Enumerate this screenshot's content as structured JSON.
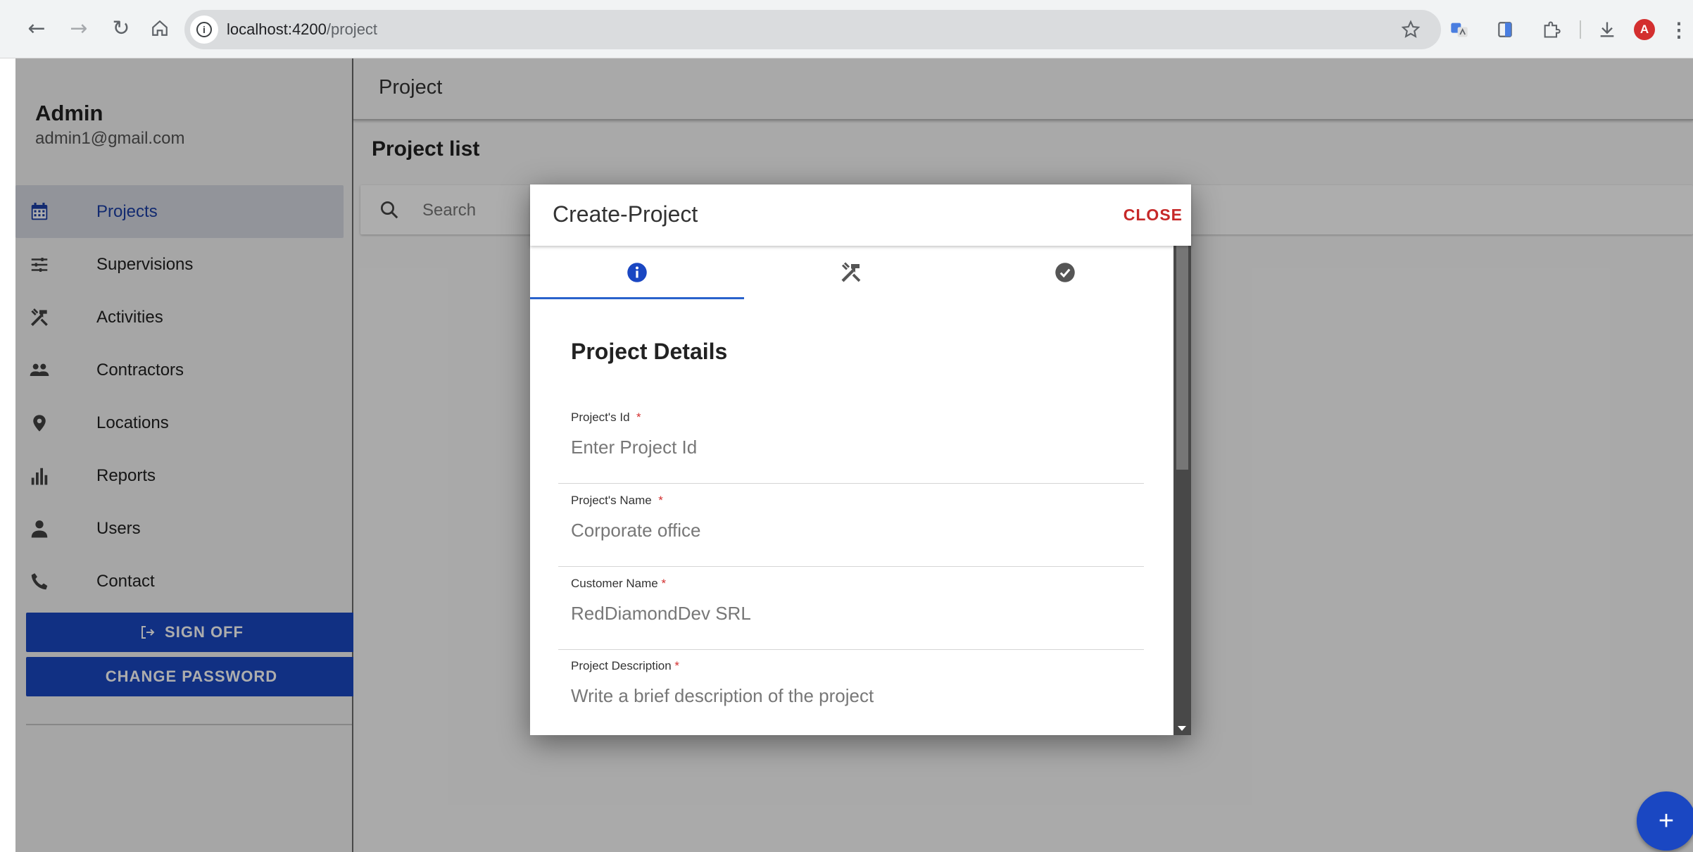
{
  "browser": {
    "url_host": "localhost:4200",
    "url_path": "/project",
    "profile_initial": "A"
  },
  "user": {
    "name": "Admin",
    "email": "admin1@gmail.com"
  },
  "sidebar": {
    "items": [
      {
        "label": "Projects",
        "icon": "calendar-icon",
        "active": true
      },
      {
        "label": "Supervisions",
        "icon": "sliders-icon",
        "active": false
      },
      {
        "label": "Activities",
        "icon": "tools-icon",
        "active": false
      },
      {
        "label": "Contractors",
        "icon": "people-icon",
        "active": false
      },
      {
        "label": "Locations",
        "icon": "location-pin-icon",
        "active": false
      },
      {
        "label": "Reports",
        "icon": "bar-chart-icon",
        "active": false
      },
      {
        "label": "Users",
        "icon": "person-icon",
        "active": false
      },
      {
        "label": "Contact",
        "icon": "phone-icon",
        "active": false
      }
    ],
    "sign_off_label": "SIGN OFF",
    "change_password_label": "CHANGE PASSWORD"
  },
  "header": {
    "title": "Project"
  },
  "main": {
    "list_title": "Project list",
    "search_placeholder": "Search"
  },
  "dialog": {
    "title": "Create-Project",
    "close_label": "CLOSE",
    "steps": [
      {
        "icon": "info-icon",
        "active": true
      },
      {
        "icon": "tools-icon",
        "active": false
      },
      {
        "icon": "check-circle-icon",
        "active": false
      }
    ],
    "section_title": "Project Details",
    "fields": [
      {
        "label": "Project's Id",
        "required_mark": "*",
        "placeholder": "Enter Project Id"
      },
      {
        "label": "Project's Name",
        "required_mark": "*",
        "placeholder": "Corporate office"
      },
      {
        "label": "Customer Name",
        "required_mark": "*",
        "placeholder": "RedDiamondDev SRL"
      },
      {
        "label": "Project Description",
        "required_mark": "*",
        "placeholder": "Write a brief description of the project"
      }
    ]
  },
  "fab": {
    "label": "+"
  },
  "colors": {
    "primary": "#1a47c2",
    "active_tab": "#2962cc",
    "close": "#c62828",
    "required": "#d32f2f"
  }
}
